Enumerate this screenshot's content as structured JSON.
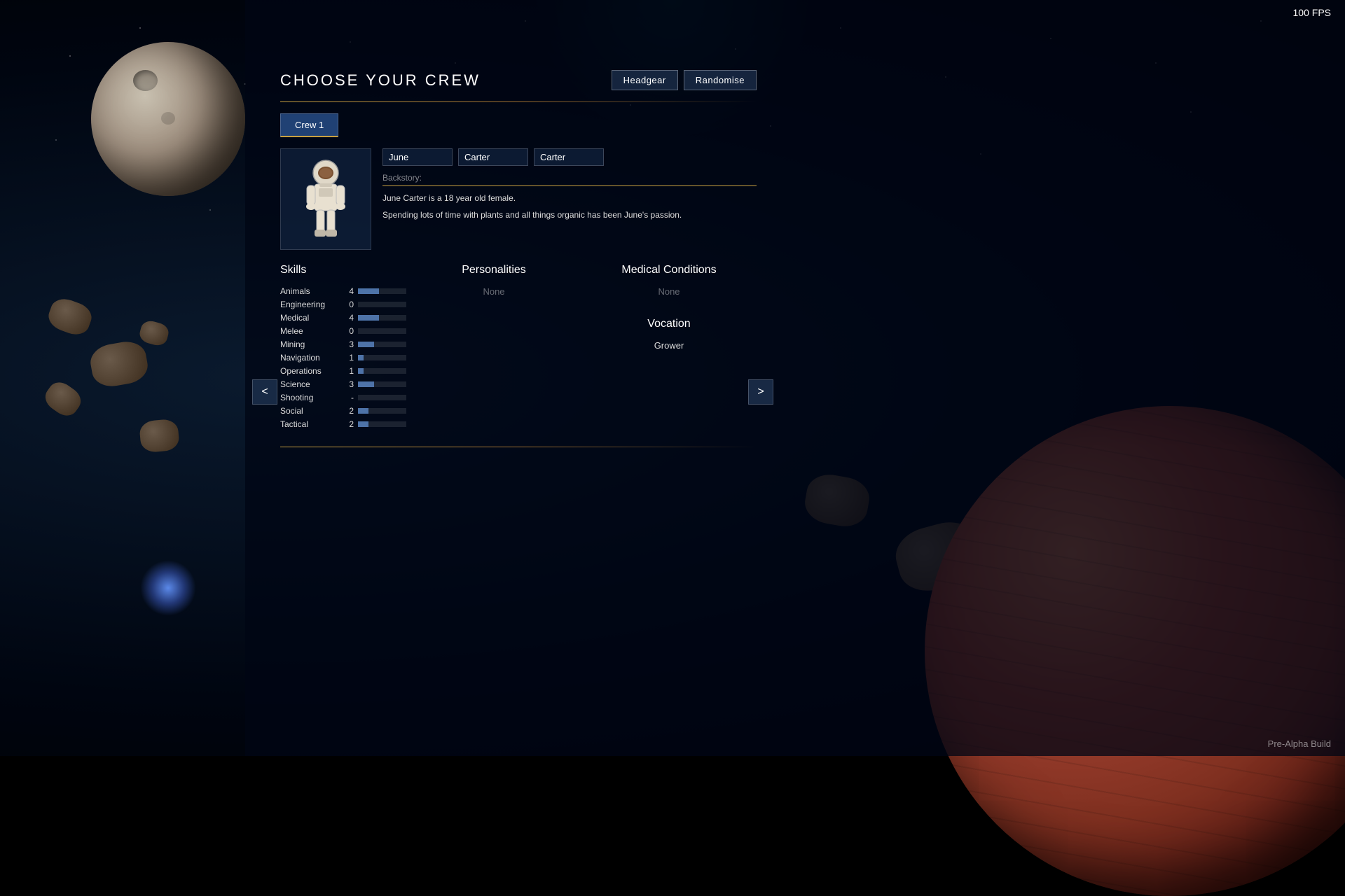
{
  "fps": "100 FPS",
  "build_label": "Pre-Alpha Build",
  "title": "CHOOSE YOUR CREW",
  "buttons": {
    "headgear": "Headgear",
    "randomise": "Randomise"
  },
  "tabs": [
    {
      "label": "Crew 1",
      "active": true
    }
  ],
  "character": {
    "first_name": "June",
    "last_name1": "Carter",
    "last_name2": "Carter",
    "backstory_label": "Backstory:",
    "backstory_line1": "June Carter is a 18 year old female.",
    "backstory_line2": "Spending lots of time with plants and all things organic has been June's passion."
  },
  "skills": {
    "title": "Skills",
    "items": [
      {
        "name": "Animals",
        "value": "4",
        "bar": 0.5
      },
      {
        "name": "Engineering",
        "value": "0",
        "bar": 0
      },
      {
        "name": "Medical",
        "value": "4",
        "bar": 0.5
      },
      {
        "name": "Melee",
        "value": "0",
        "bar": 0
      },
      {
        "name": "Mining",
        "value": "3",
        "bar": 0.375
      },
      {
        "name": "Navigation",
        "value": "1",
        "bar": 0.125
      },
      {
        "name": "Operations",
        "value": "1",
        "bar": 0.125
      },
      {
        "name": "Science",
        "value": "3",
        "bar": 0.375
      },
      {
        "name": "Shooting",
        "value": "-",
        "bar": 0
      },
      {
        "name": "Social",
        "value": "2",
        "bar": 0.25
      },
      {
        "name": "Tactical",
        "value": "2",
        "bar": 0.25
      }
    ]
  },
  "personalities": {
    "title": "Personalities",
    "value": "None"
  },
  "medical": {
    "title": "Medical Conditions",
    "value": "None"
  },
  "vocation": {
    "title": "Vocation",
    "value": "Grower"
  },
  "nav": {
    "left": "<",
    "right": ">"
  },
  "colors": {
    "gold": "#c8a040",
    "panel_bg": "rgba(0,5,20,0.75)",
    "tab_active": "rgba(40,80,140,0.8)",
    "skill_bar": "rgba(100,150,220,0.7)"
  }
}
